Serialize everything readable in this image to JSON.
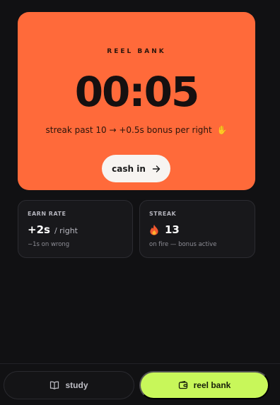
{
  "hero": {
    "label": "REEL BANK",
    "timer": "00:05",
    "subtitle": "streak past 10 → +0.5s bonus per right",
    "subtitle_emoji": "✋",
    "cash_button": "cash in",
    "accent_color": "#ff6a3a"
  },
  "stats": {
    "earn": {
      "label": "EARN RATE",
      "value": "+2s",
      "unit": "/ right",
      "note": "−1s on wrong"
    },
    "streak": {
      "label": "STREAK",
      "value": "13",
      "icon": "flame-icon",
      "note": "on fire — bonus active"
    }
  },
  "nav": {
    "study_label": "study",
    "study_icon": "book-icon",
    "bank_label": "reel bank",
    "bank_icon": "wallet-icon",
    "active": "reel bank",
    "active_color": "#c8f75a"
  }
}
